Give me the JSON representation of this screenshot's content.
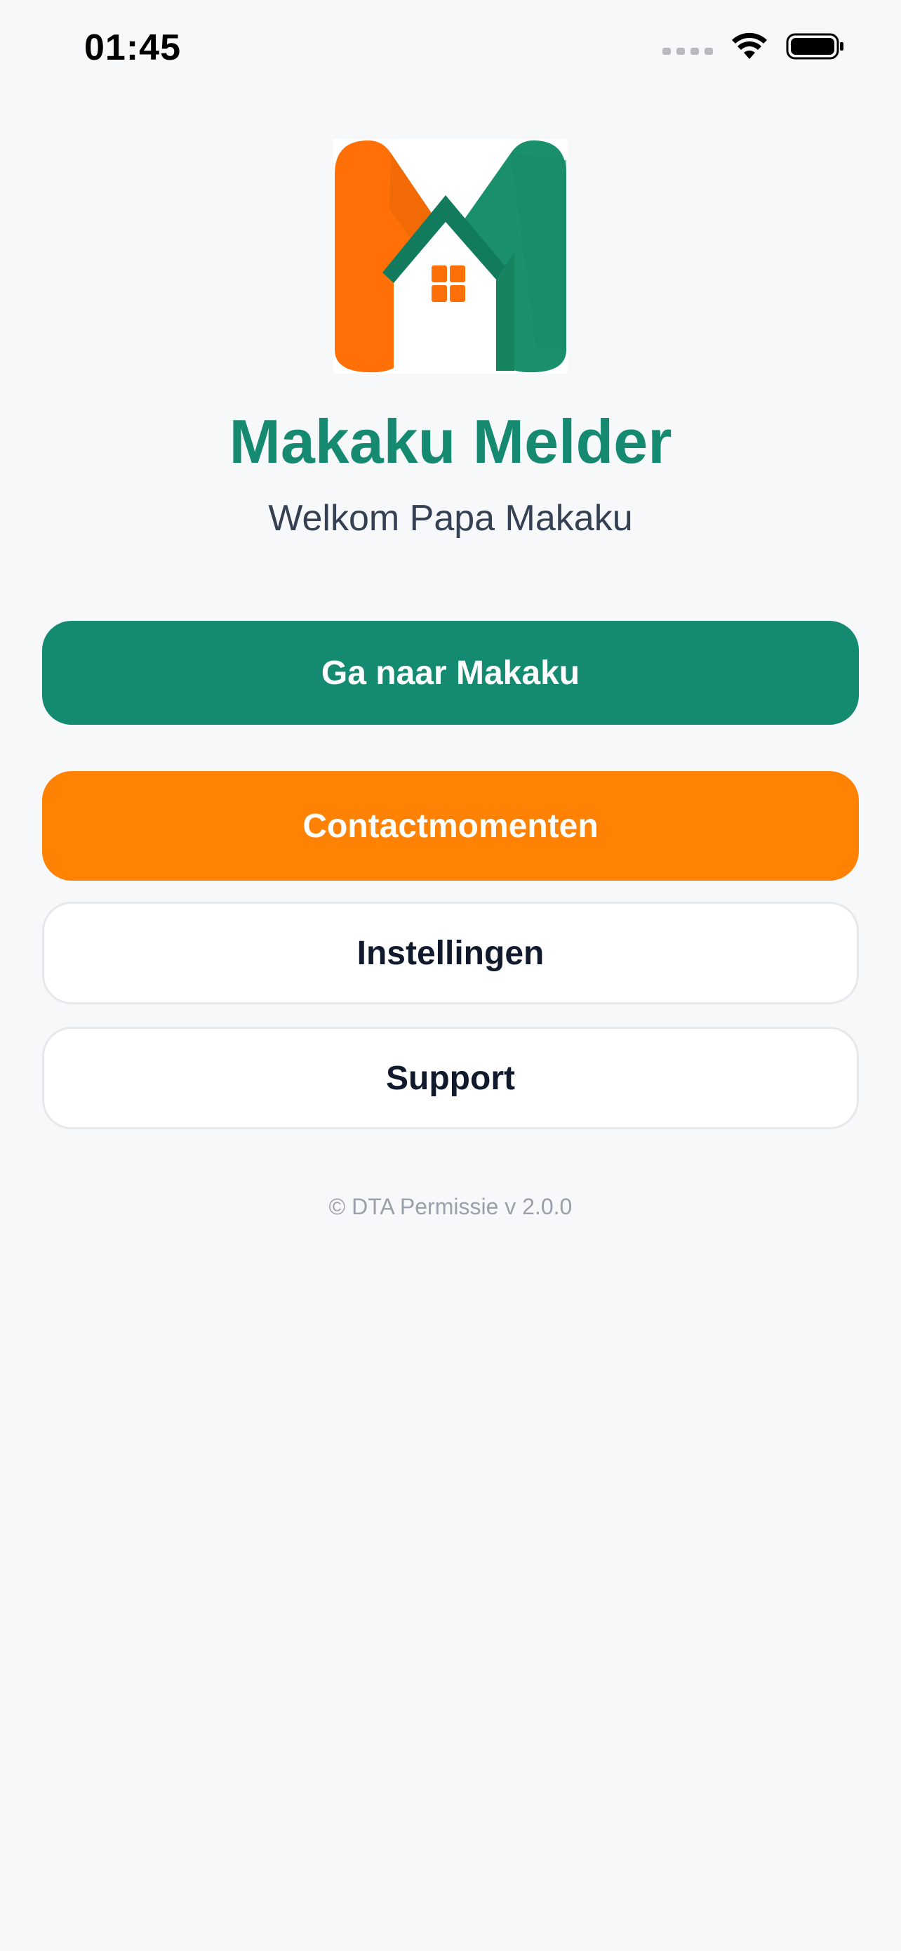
{
  "status_bar": {
    "time": "01:45",
    "icons": [
      "cellular-signal-icon",
      "wifi-icon",
      "battery-icon"
    ]
  },
  "app": {
    "logo_icon": "makaku-house-logo-icon",
    "title": "Makaku Melder",
    "welcome": "Welkom Papa Makaku"
  },
  "buttons": {
    "primary": "Ga naar Makaku",
    "contact": "Contactmomenten",
    "settings": "Instellingen",
    "support": "Support"
  },
  "footer": {
    "copyright": "© DTA Permissie v 2.0.0"
  },
  "colors": {
    "background": "#f7f8fa",
    "brand_green": "#148a71",
    "brand_orange": "#ff8205",
    "title_green": "#168a70"
  }
}
